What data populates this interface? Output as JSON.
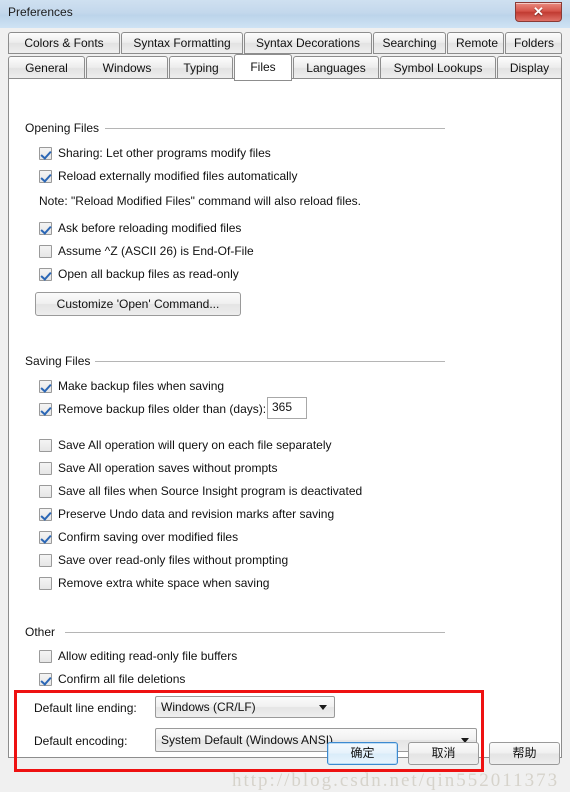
{
  "window": {
    "title": "Preferences",
    "close_label": "✕",
    "close_icon": "close-icon"
  },
  "tabs": {
    "row1": [
      {
        "label": "Colors & Fonts",
        "selected": false
      },
      {
        "label": "Syntax Formatting",
        "selected": false
      },
      {
        "label": "Syntax Decorations",
        "selected": false
      },
      {
        "label": "Searching",
        "selected": false
      },
      {
        "label": "Remote",
        "selected": false
      },
      {
        "label": "Folders",
        "selected": false
      }
    ],
    "row2": [
      {
        "label": "General",
        "selected": false
      },
      {
        "label": "Windows",
        "selected": false
      },
      {
        "label": "Typing",
        "selected": false
      },
      {
        "label": "Files",
        "selected": true
      },
      {
        "label": "Languages",
        "selected": false
      },
      {
        "label": "Symbol Lookups",
        "selected": false
      },
      {
        "label": "Display",
        "selected": false
      }
    ]
  },
  "groups": {
    "opening": {
      "title": "Opening Files",
      "checkboxes": [
        {
          "label": "Sharing: Let other programs modify files",
          "checked": true
        },
        {
          "label": "Reload externally modified files automatically",
          "checked": true
        },
        {
          "label": "Ask before reloading modified files",
          "checked": true
        },
        {
          "label": "Assume ^Z (ASCII 26) is End-Of-File",
          "checked": false
        },
        {
          "label": "Open all backup files as read-only",
          "checked": true
        }
      ],
      "note": "Note: \"Reload Modified Files\" command will also reload files.",
      "customize_button": "Customize 'Open' Command..."
    },
    "saving": {
      "title": "Saving Files",
      "checkbox_backup": {
        "label": "Make backup files when saving",
        "checked": true
      },
      "checkbox_remove_old": {
        "label": "Remove backup files older than (days):",
        "checked": true
      },
      "days_value": "365",
      "checkboxes": [
        {
          "label": "Save All operation will query on each file separately",
          "checked": false
        },
        {
          "label": "Save All operation saves without prompts",
          "checked": false
        },
        {
          "label": "Save all files when Source Insight program is deactivated",
          "checked": false
        },
        {
          "label": "Preserve Undo data and revision marks after saving",
          "checked": true
        },
        {
          "label": "Confirm saving over modified files",
          "checked": true
        },
        {
          "label": "Save over read-only files without prompting",
          "checked": false
        },
        {
          "label": "Remove extra white space when saving",
          "checked": false
        }
      ]
    },
    "other": {
      "title": "Other",
      "checkboxes": [
        {
          "label": "Allow editing read-only file buffers",
          "checked": false
        },
        {
          "label": "Confirm all file deletions",
          "checked": true
        }
      ],
      "line_ending_label": "Default line ending:",
      "line_ending_value": "Windows (CR/LF)",
      "encoding_label": "Default encoding:",
      "encoding_value": "System Default (Windows ANSI)"
    }
  },
  "footer": {
    "ok_label": "确定",
    "cancel_label": "取消",
    "help_label": "帮助"
  },
  "watermark": {
    "text": "http://blog.csdn.net/qin552011373"
  },
  "colors": {
    "annotation": "#ee1111",
    "titlebar": "#c3d8ec",
    "close_button": "#c13b32",
    "checkmark": "#2a66b5",
    "default_button_border": "#3c8ad0"
  }
}
